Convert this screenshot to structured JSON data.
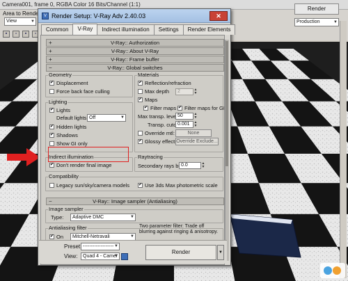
{
  "framebuffer": {
    "title": "Camera001, frame 0, RGBA Color 16 Bits/Channel (1:1)",
    "area_label": "Area to Render:",
    "area_value": "View",
    "render_button": "Render",
    "production_value": "Production"
  },
  "dialog": {
    "title": "Render Setup: V-Ray Adv 2.40.03",
    "tabs": [
      "Common",
      "V-Ray",
      "Indirect illumination",
      "Settings",
      "Render Elements"
    ],
    "active_tab": "V-Ray",
    "rollouts": {
      "authorization": "V-Ray:: Authorization",
      "about": "V-Ray:: About V-Ray",
      "frame_buffer": "V-Ray:: Frame buffer",
      "global_switches": "V-Ray:: Global switches",
      "image_sampler": "V-Ray:: Image sampler (Antialiasing)"
    },
    "geometry": {
      "title": "Geometry",
      "displacement": "Displacement",
      "force_back_face": "Force back face culling"
    },
    "lighting": {
      "title": "Lighting",
      "lights": "Lights",
      "default_lights_label": "Default lights",
      "default_lights_value": "Off",
      "hidden_lights": "Hidden lights",
      "shadows": "Shadows",
      "show_gi_only": "Show GI only"
    },
    "materials": {
      "title": "Materials",
      "reflection_refraction": "Reflection/refraction",
      "max_depth_label": "Max depth",
      "max_depth_value": "2",
      "maps": "Maps",
      "filter_maps": "Filter maps",
      "filter_maps_gi": "Filter maps for GI",
      "max_transp_label": "Max transp. levels",
      "max_transp_value": "50",
      "transp_cutoff_label": "Transp. cutoff",
      "transp_cutoff_value": "0.001",
      "override_mtl": "Override mtl:",
      "override_mtl_btn": "None",
      "glossy_effects": "Glossy effects",
      "override_exclude_btn": "Override Exclude..."
    },
    "indirect_illumination": {
      "title": "Indirect illumination",
      "dont_render_final": "Don't render final image"
    },
    "raytracing": {
      "title": "Raytracing",
      "secondary_bias_label": "Secondary rays bias",
      "secondary_bias_value": "0.0"
    },
    "compatibility": {
      "title": "Compatibility",
      "legacy_sun": "Legacy sun/sky/camera models",
      "use_3dsmax_photometric": "Use 3ds Max photometric scale"
    },
    "image_sampler": {
      "title": "Image sampler",
      "type_label": "Type:",
      "type_value": "Adaptive DMC"
    },
    "aa_filter": {
      "title": "Antialiasing filter",
      "on_label": "On",
      "filter_value": "Mitchell-Netravali",
      "description": "Two parameter filter: Trade off blurring against ringing & anisotropy."
    },
    "bottom": {
      "preset_label": "Preset:",
      "preset_value": "-------------------",
      "view_label": "View:",
      "view_value": "Quad 4 - Camer",
      "render_button": "Render"
    }
  },
  "colors": {
    "highlight": "#e02020",
    "title_bar": "#a4c0e3",
    "close_button": "#c84236"
  }
}
